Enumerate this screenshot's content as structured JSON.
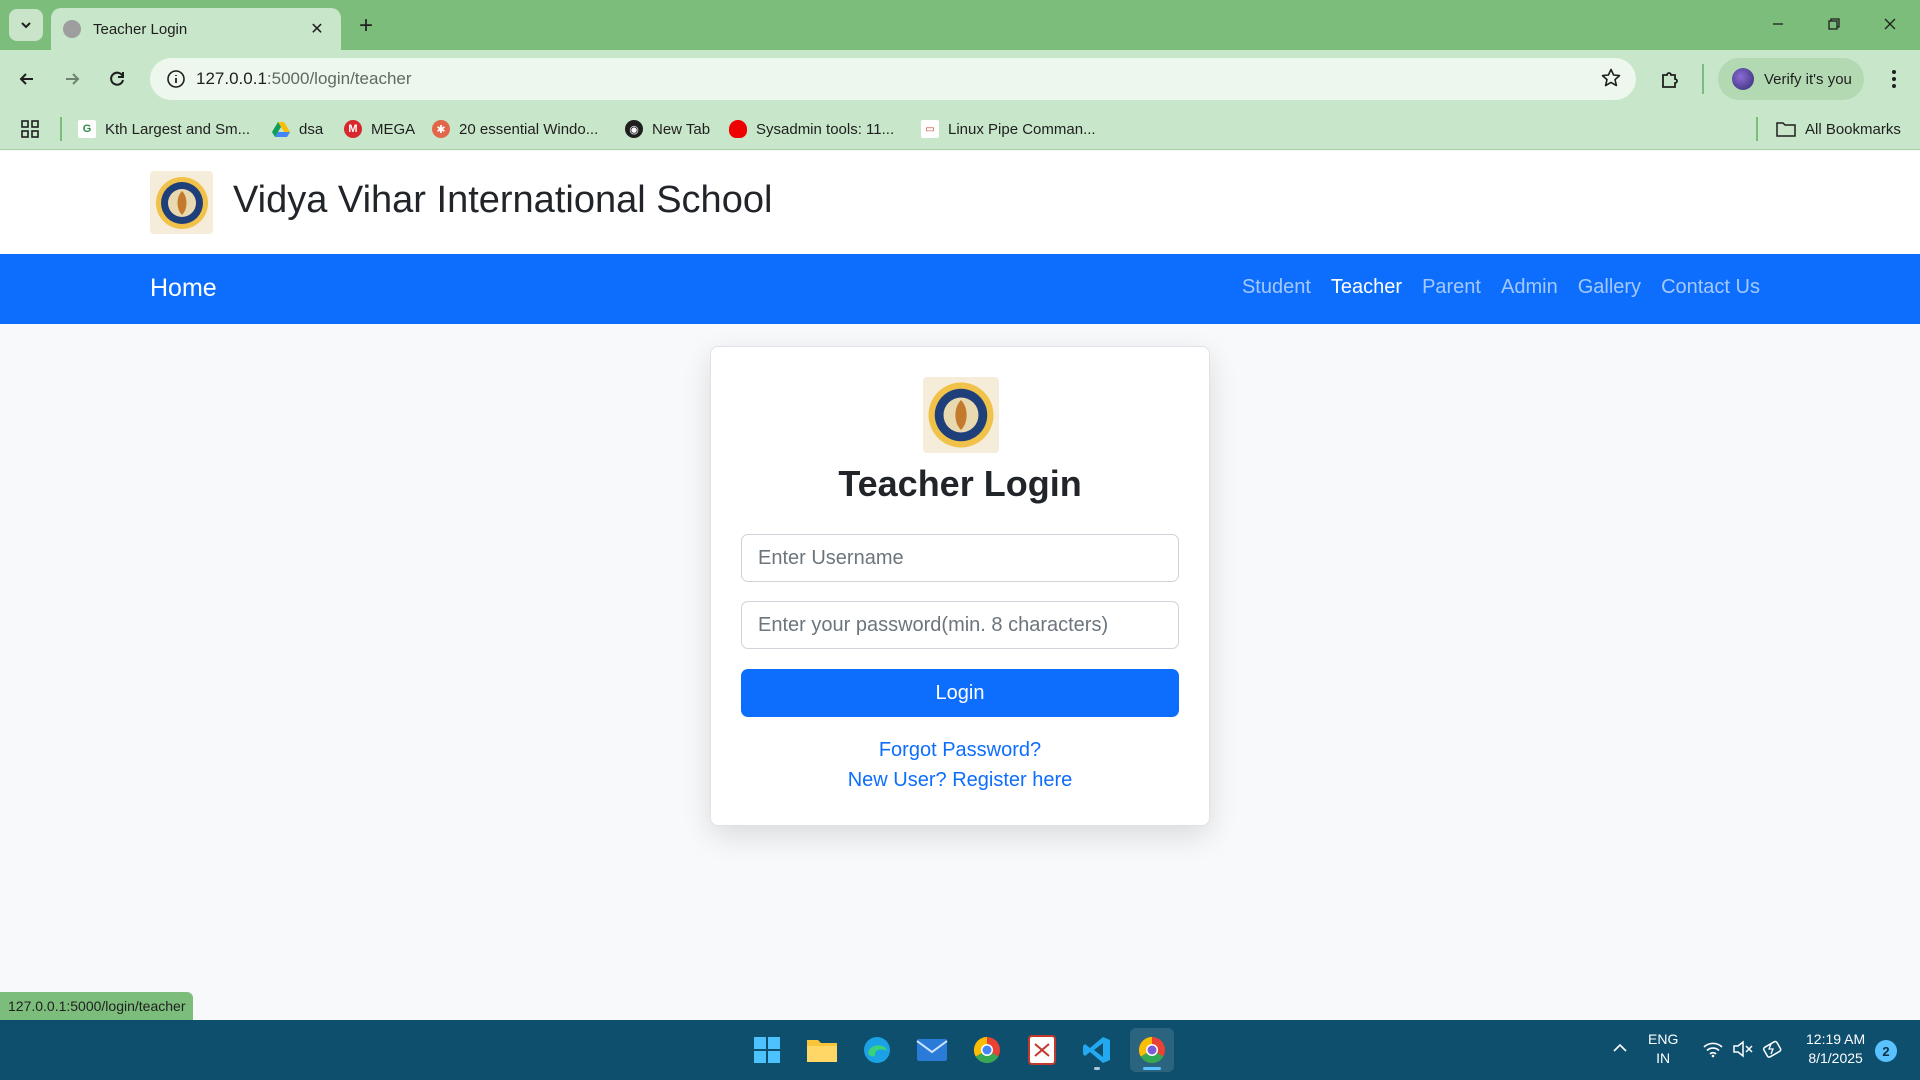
{
  "browser": {
    "tab_title": "Teacher Login",
    "url_host": "127.0.0.1",
    "url_rest": ":5000/login/teacher",
    "verify_label": "Verify it's you",
    "bookmarks": [
      {
        "label": "Kth Largest and Sm...",
        "icon": "gfg-icon"
      },
      {
        "label": "dsa",
        "icon": "google-drive-icon"
      },
      {
        "label": "MEGA",
        "icon": "mega-icon"
      },
      {
        "label": "20 essential Windo...",
        "icon": "site-icon"
      },
      {
        "label": "New Tab",
        "icon": "globe-icon"
      },
      {
        "label": "Sysadmin tools: 11...",
        "icon": "redhat-icon"
      },
      {
        "label": "Linux Pipe Comman...",
        "icon": "site-icon"
      }
    ],
    "all_bookmarks": "All Bookmarks",
    "status_url": "127.0.0.1:5000/login/teacher"
  },
  "site": {
    "title": "Vidya Vihar International School",
    "nav_home": "Home",
    "nav_links": [
      "Student",
      "Teacher",
      "Parent",
      "Admin",
      "Gallery",
      "Contact Us"
    ],
    "active_link": "Teacher"
  },
  "login": {
    "heading": "Teacher Login",
    "username_placeholder": "Enter Username",
    "password_placeholder": "Enter your password(min. 8 characters)",
    "login_button": "Login",
    "forgot_link": "Forgot Password?",
    "register_link": "New User? Register here"
  },
  "taskbar": {
    "lang_line1": "ENG",
    "lang_line2": "IN",
    "time": "12:19 AM",
    "date": "8/1/2025",
    "notifications": "2"
  },
  "colors": {
    "primary": "#0d6efd",
    "chrome_green": "#7cbd7c",
    "taskbar": "#0e4f6e"
  }
}
